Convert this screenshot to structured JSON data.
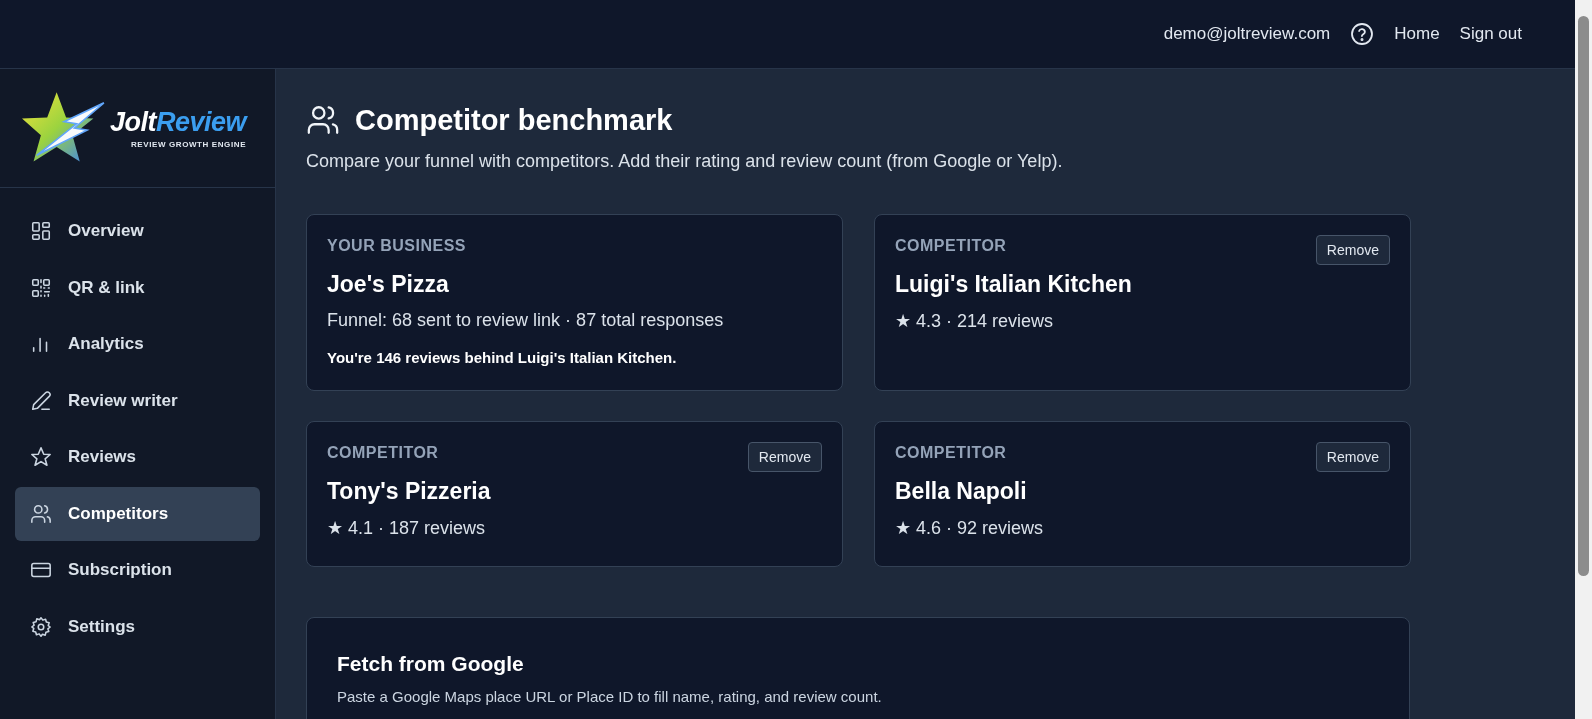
{
  "top_bar": {
    "email": "demo@joltreview.com",
    "links": [
      "Home",
      "Sign out"
    ]
  },
  "logo": {
    "name_first": "Jolt",
    "name_second": "Review",
    "tagline": "REVIEW GROWTH ENGINE"
  },
  "sidebar": {
    "items": [
      {
        "label": "Overview",
        "kind": "grid",
        "selected": false
      },
      {
        "label": "QR & link",
        "kind": "qr",
        "selected": false
      },
      {
        "label": "Analytics",
        "kind": "bars",
        "selected": false
      },
      {
        "label": "Review writer",
        "kind": "pen",
        "selected": false
      },
      {
        "label": "Reviews",
        "kind": "star",
        "selected": false
      },
      {
        "label": "Competitors",
        "kind": "users",
        "selected": true
      },
      {
        "label": "Subscription",
        "kind": "card",
        "selected": false
      },
      {
        "label": "Settings",
        "kind": "gear",
        "selected": false
      }
    ]
  },
  "page": {
    "title": "Competitor benchmark",
    "subtitle": "Compare your funnel with competitors. Add their rating and review count (from Google or Yelp)."
  },
  "cards": [
    {
      "kind": "own",
      "eyebrow": "YOUR BUSINESS",
      "name": "Joe's Pizza",
      "detail": "Funnel: 68 sent to review link · 87 total responses",
      "note": "You're 146 reviews behind Luigi's Italian Kitchen."
    },
    {
      "kind": "competitor",
      "eyebrow": "COMPETITOR",
      "name": "Luigi's Italian Kitchen",
      "detail": "★ 4.3 · 214 reviews",
      "action": "Remove"
    },
    {
      "kind": "competitor",
      "eyebrow": "COMPETITOR",
      "name": "Tony's Pizzeria",
      "detail": "★ 4.1 · 187 reviews",
      "action": "Remove"
    },
    {
      "kind": "competitor",
      "eyebrow": "COMPETITOR",
      "name": "Bella Napoli",
      "detail": "★ 4.6 · 92 reviews",
      "action": "Remove"
    }
  ],
  "fetch_panel": {
    "title": "Fetch from Google",
    "description": "Paste a Google Maps place URL or Place ID to fill name, rating, and review count."
  }
}
